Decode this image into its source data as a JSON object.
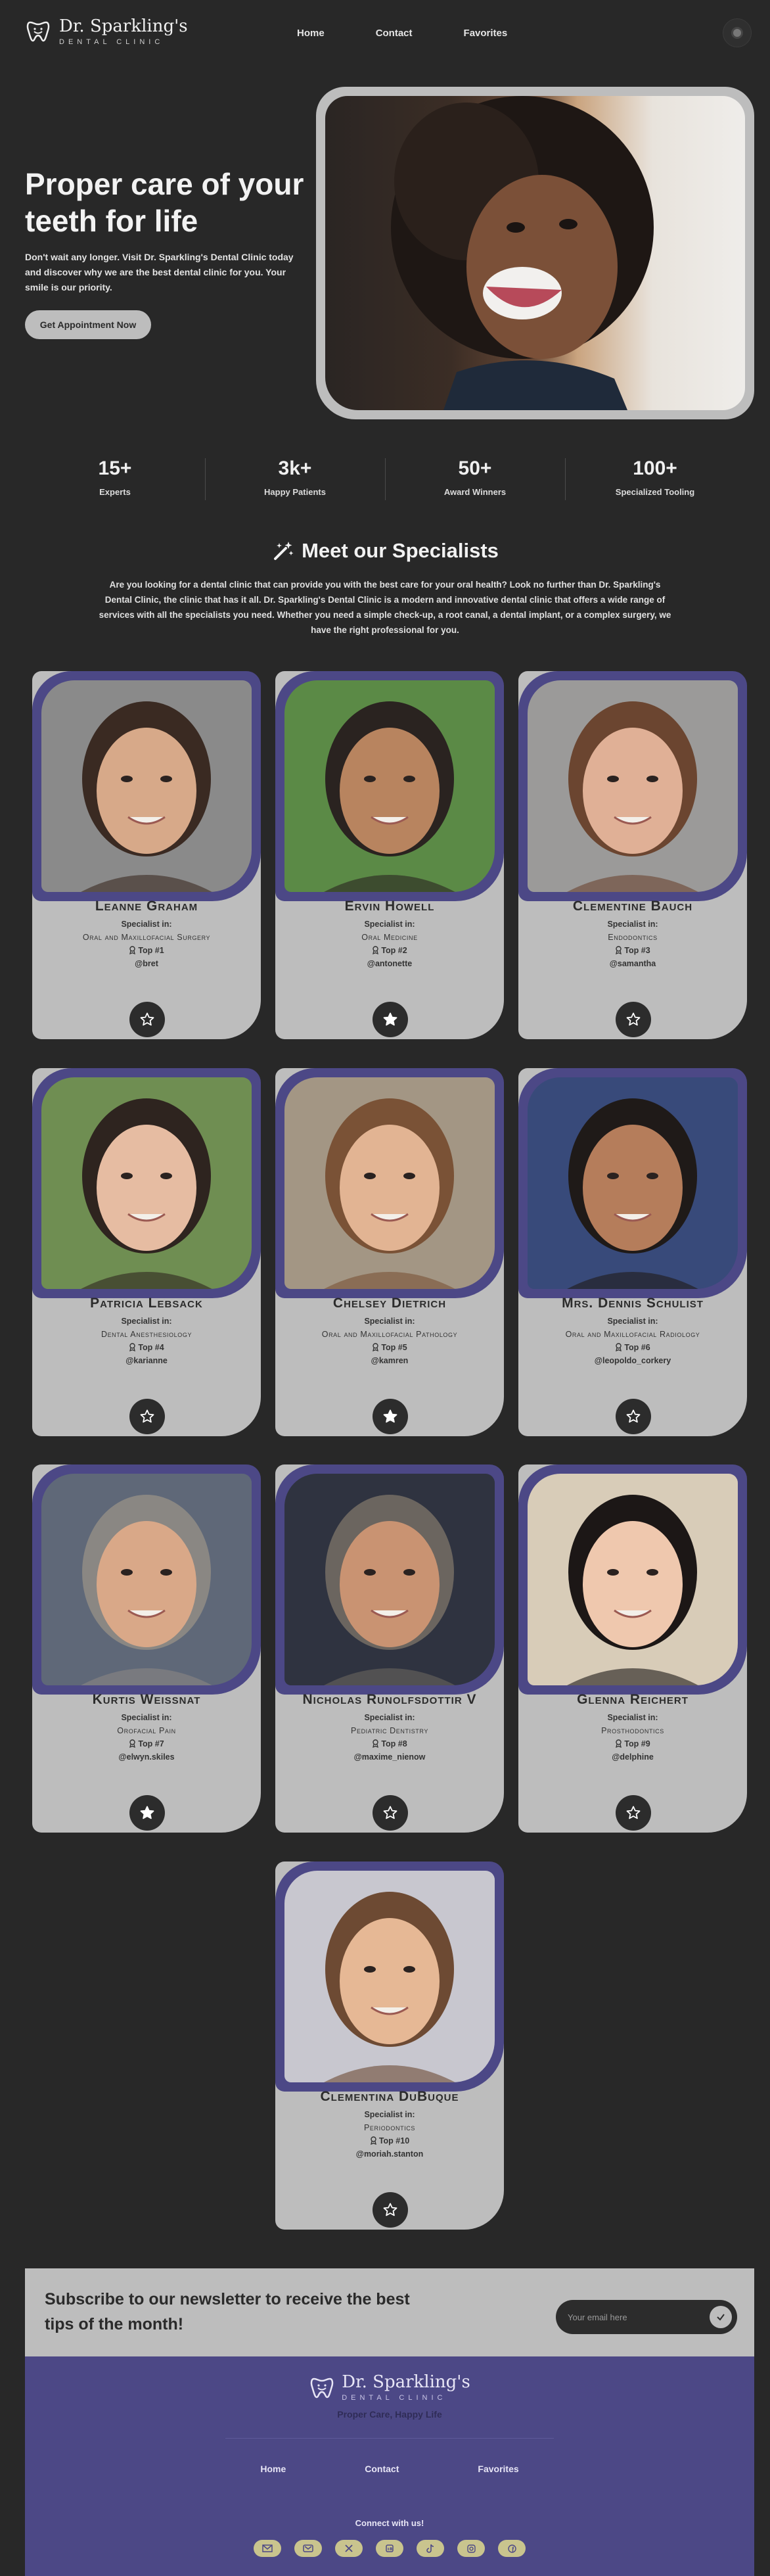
{
  "brand": {
    "name": "Dr. Sparkling's",
    "tagline": "DENTAL CLINIC"
  },
  "nav": {
    "items": [
      "Home",
      "Contact",
      "Favorites"
    ]
  },
  "hero": {
    "title": "Proper care of your teeth for life",
    "description": "Don't wait any longer. Visit Dr. Sparkling's Dental Clinic today and discover why we are the best dental clinic for you. Your smile is our priority.",
    "cta": "Get Appointment Now"
  },
  "stats": [
    {
      "value": "15+",
      "label": "Experts"
    },
    {
      "value": "3k+",
      "label": "Happy Patients"
    },
    {
      "value": "50+",
      "label": "Award Winners"
    },
    {
      "value": "100+",
      "label": "Specialized Tooling"
    }
  ],
  "specialists": {
    "title": "Meet our Specialists",
    "description": "Are you looking for a dental clinic that can provide you with the best care for your oral health? Look no further than Dr. Sparkling's Dental Clinic, the clinic that has it all. Dr. Sparkling's Dental Clinic is a modern and innovative dental clinic that offers a wide range of services with all the specialists you need. Whether you need a simple check-up, a root canal, a dental implant, or a complex surgery, we have the right professional for you.",
    "specialist_in_label": "Specialist in:",
    "cards": [
      {
        "name": "Leanne Graham",
        "field": "Oral and Maxillofacial Surgery",
        "rank": "Top #1",
        "handle": "@bret",
        "favorite": false,
        "bg": "#8a8a8a",
        "skin": "#d7a989",
        "hair": "#3a2a22"
      },
      {
        "name": "Ervin Howell",
        "field": "Oral Medicine",
        "rank": "Top #2",
        "handle": "@antonette",
        "favorite": true,
        "bg": "#5b8a46",
        "skin": "#b8845f",
        "hair": "#2a2320"
      },
      {
        "name": "Clementine Bauch",
        "field": "Endodontics",
        "rank": "Top #3",
        "handle": "@samantha",
        "favorite": false,
        "bg": "#9b9a99",
        "skin": "#e0b096",
        "hair": "#6b4530"
      },
      {
        "name": "Patricia Lebsack",
        "field": "Dental Anesthesiology",
        "rank": "Top #4",
        "handle": "@karianne",
        "favorite": false,
        "bg": "#6f8e52",
        "skin": "#e6bca2",
        "hair": "#2e241f"
      },
      {
        "name": "Chelsey Dietrich",
        "field": "Oral and Maxillofacial Pathology",
        "rank": "Top #5",
        "handle": "@kamren",
        "favorite": true,
        "bg": "#a39684",
        "skin": "#e2b493",
        "hair": "#7a5236"
      },
      {
        "name": "Mrs. Dennis Schulist",
        "field": "Oral and Maxillofacial Radiology",
        "rank": "Top #6",
        "handle": "@leopoldo_corkery",
        "favorite": false,
        "bg": "#384a7a",
        "skin": "#b57d5b",
        "hair": "#1f1a18"
      },
      {
        "name": "Kurtis Weissnat",
        "field": "Orofacial Pain",
        "rank": "Top #7",
        "handle": "@elwyn.skiles",
        "favorite": true,
        "bg": "#5f6878",
        "skin": "#d9a888",
        "hair": "#8a8783"
      },
      {
        "name": "Nicholas Runolfsdottir V",
        "field": "Pediatric Dentistry",
        "rank": "Top #8",
        "handle": "@maxime_nienow",
        "favorite": false,
        "bg": "#2f3340",
        "skin": "#c99372",
        "hair": "#6b655f"
      },
      {
        "name": "Glenna Reichert",
        "field": "Prosthodontics",
        "rank": "Top #9",
        "handle": "@delphine",
        "favorite": false,
        "bg": "#d8ccb8",
        "skin": "#efc8ae",
        "hair": "#1c1716"
      },
      {
        "name": "Clementina DuBuque",
        "field": "Periodontics",
        "rank": "Top #10",
        "handle": "@moriah.stanton",
        "favorite": false,
        "bg": "#c8c7cf",
        "skin": "#e6b895",
        "hair": "#6d4a33"
      }
    ]
  },
  "newsletter": {
    "text": "Subscribe to our newsletter to receive the best tips of the month!",
    "placeholder": "Your email here"
  },
  "footer": {
    "slogan": "Proper Care, Happy Life",
    "nav": [
      "Home",
      "Contact",
      "Favorites"
    ],
    "connect": "Connect with us!",
    "socials": [
      "mail-icon",
      "envelope-icon",
      "x-icon",
      "linkedin-icon",
      "tiktok-icon",
      "instagram-icon",
      "facebook-icon"
    ]
  },
  "colors": {
    "background": "#282828",
    "accent": "#4c4886",
    "card": "#bdbdbd",
    "social": "#c9c48e"
  }
}
